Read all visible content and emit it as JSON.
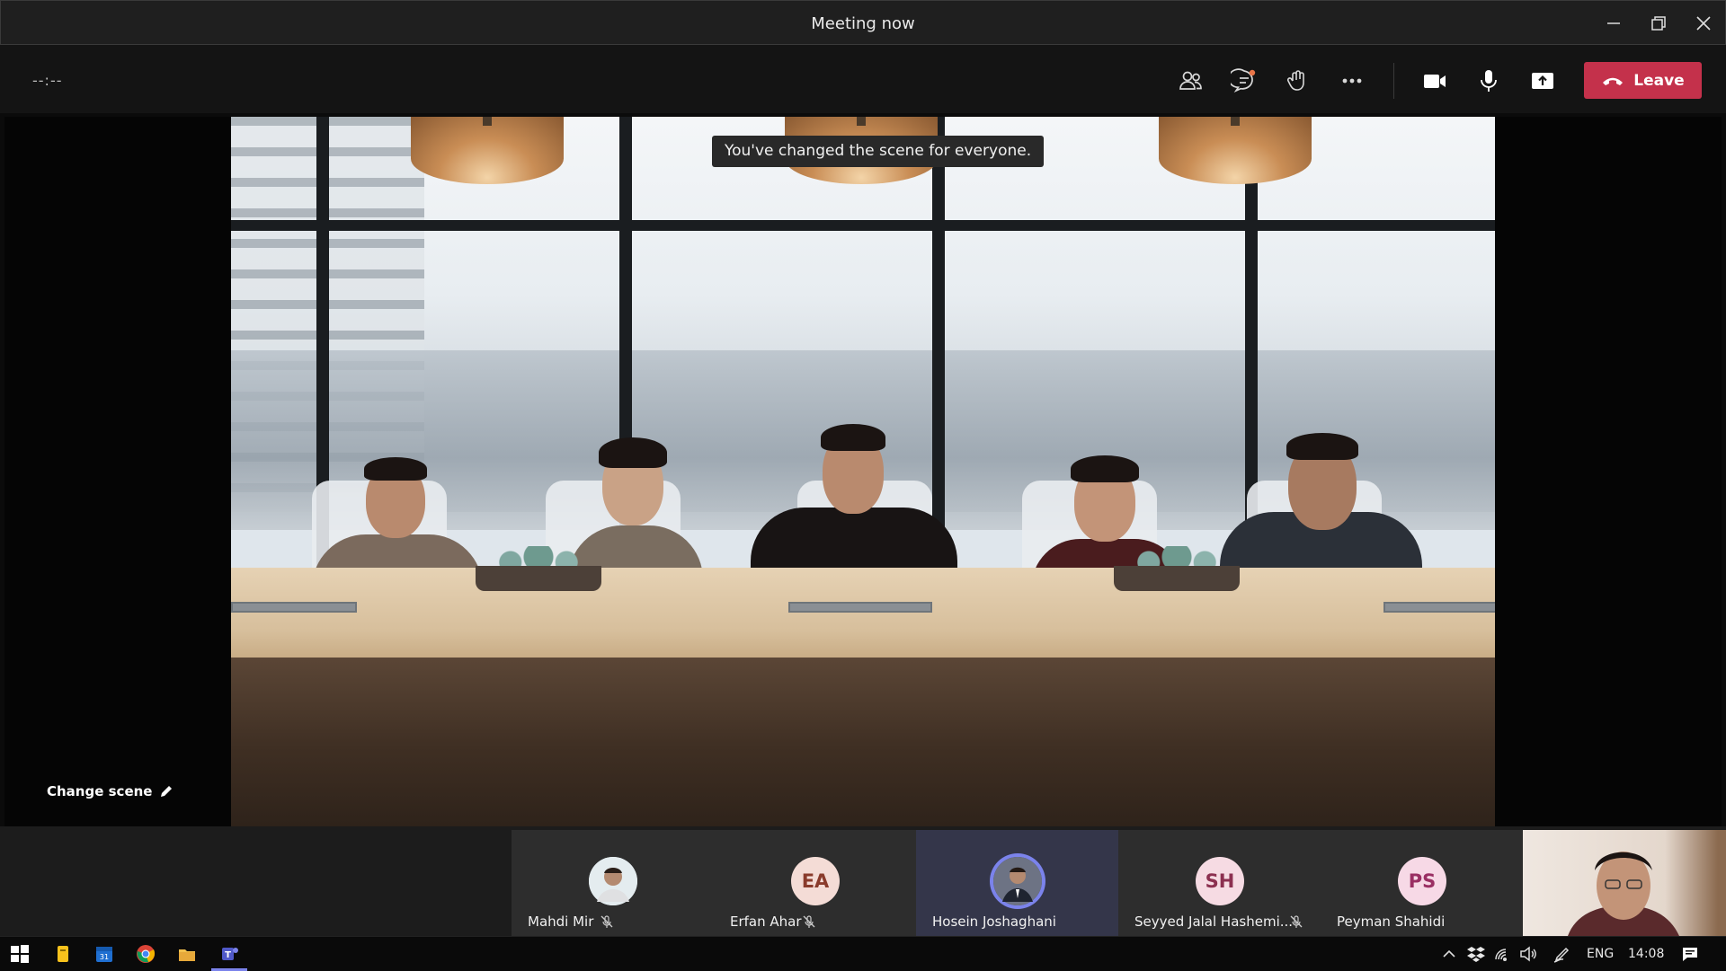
{
  "window": {
    "title": "Meeting now"
  },
  "toolbar": {
    "timer": "--:--",
    "buttons": [
      "show-participants",
      "show-conversation",
      "raise-hand",
      "more-actions",
      "camera",
      "microphone",
      "share-content"
    ],
    "leave_label": "Leave",
    "accent_color": "#c4314b"
  },
  "stage": {
    "toast": "You've changed the scene for everyone.",
    "change_scene_label": "Change scene"
  },
  "participants": [
    {
      "name": "Mahdi Mir",
      "initials": "",
      "has_photo": true,
      "muted": true,
      "speaking": false,
      "avatar_bg": "#dfe8ee"
    },
    {
      "name": "Erfan Ahar",
      "initials": "EA",
      "has_photo": false,
      "muted": true,
      "speaking": false,
      "avatar_bg": "#f4dcd6",
      "avatar_fg": "#8a3b2c"
    },
    {
      "name": "Hosein Joshaghani",
      "initials": "",
      "has_photo": true,
      "muted": false,
      "speaking": true,
      "avatar_bg": "#3a3f52"
    },
    {
      "name": "Seyyed Jalal Hashemi...",
      "initials": "SH",
      "has_photo": false,
      "muted": true,
      "speaking": false,
      "avatar_bg": "#f6dbe3",
      "avatar_fg": "#8c3050"
    },
    {
      "name": "Peyman Shahidi",
      "initials": "PS",
      "has_photo": false,
      "muted": false,
      "speaking": false,
      "avatar_bg": "#f7d9e6",
      "avatar_fg": "#9a2f63"
    }
  ],
  "taskbar": {
    "apps": [
      "windows-start",
      "notes",
      "calendar",
      "chrome",
      "file-explorer",
      "teams"
    ],
    "language": "ENG",
    "time": "14:08"
  }
}
